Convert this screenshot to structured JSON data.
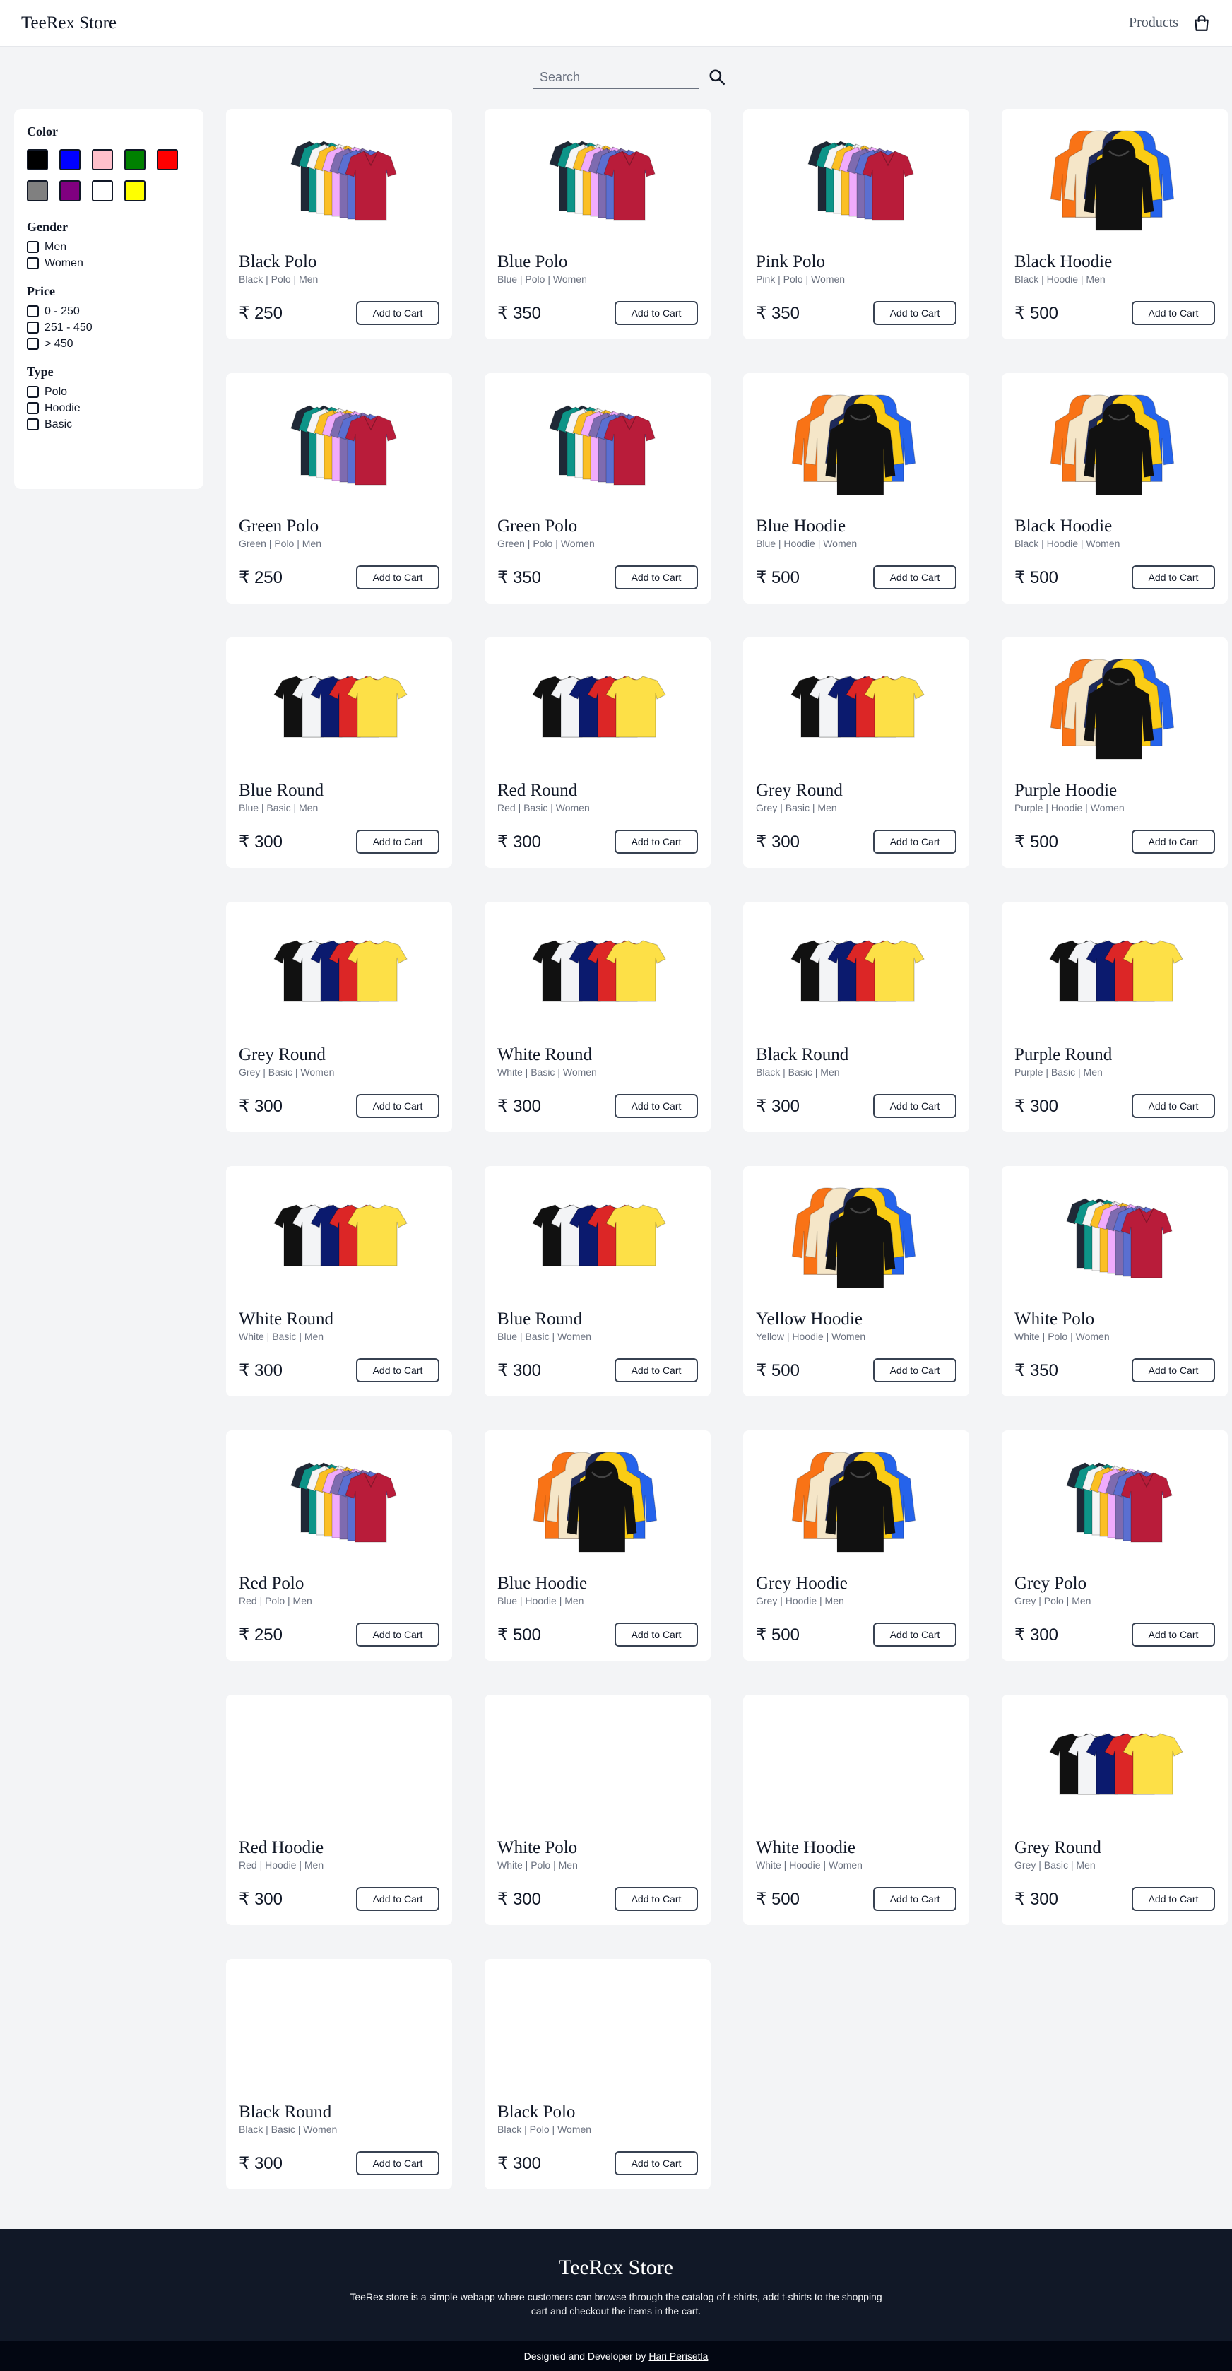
{
  "header": {
    "brand": "TeeRex Store",
    "nav_link": "Products",
    "cart_icon": "shopping-bag-icon"
  },
  "search": {
    "placeholder": "Search",
    "value": "",
    "icon": "search-icon"
  },
  "filters": {
    "color": {
      "title": "Color",
      "swatches": [
        {
          "name": "black",
          "hex": "#000000"
        },
        {
          "name": "blue",
          "hex": "#0000ff"
        },
        {
          "name": "pink",
          "hex": "#ffc0cb"
        },
        {
          "name": "green",
          "hex": "#008000"
        },
        {
          "name": "red",
          "hex": "#ff0000"
        },
        {
          "name": "grey",
          "hex": "#808080"
        },
        {
          "name": "purple",
          "hex": "#800080"
        },
        {
          "name": "white",
          "hex": "#ffffff"
        },
        {
          "name": "yellow",
          "hex": "#ffff00"
        }
      ]
    },
    "gender": {
      "title": "Gender",
      "options": [
        "Men",
        "Women"
      ]
    },
    "price": {
      "title": "Price",
      "options": [
        "0 - 250",
        "251 - 450",
        "> 450"
      ]
    },
    "type": {
      "title": "Type",
      "options": [
        "Polo",
        "Hoodie",
        "Basic"
      ]
    }
  },
  "products": [
    {
      "name": "Black Polo",
      "meta": "Black | Polo | Men",
      "price": "₹ 250",
      "image": "polo",
      "button": "Add to Cart"
    },
    {
      "name": "Blue Polo",
      "meta": "Blue | Polo | Women",
      "price": "₹ 350",
      "image": "polo",
      "button": "Add to Cart"
    },
    {
      "name": "Pink Polo",
      "meta": "Pink | Polo | Women",
      "price": "₹ 350",
      "image": "polo",
      "button": "Add to Cart"
    },
    {
      "name": "Black Hoodie",
      "meta": "Black | Hoodie | Men",
      "price": "₹ 500",
      "image": "hoodie",
      "button": "Add to Cart"
    },
    {
      "name": "Green Polo",
      "meta": "Green | Polo | Men",
      "price": "₹ 250",
      "image": "polo",
      "button": "Add to Cart"
    },
    {
      "name": "Green Polo",
      "meta": "Green | Polo | Women",
      "price": "₹ 350",
      "image": "polo",
      "button": "Add to Cart"
    },
    {
      "name": "Blue Hoodie",
      "meta": "Blue | Hoodie | Women",
      "price": "₹ 500",
      "image": "hoodie",
      "button": "Add to Cart"
    },
    {
      "name": "Black Hoodie",
      "meta": "Black | Hoodie | Women",
      "price": "₹ 500",
      "image": "hoodie",
      "button": "Add to Cart"
    },
    {
      "name": "Blue Round",
      "meta": "Blue | Basic | Men",
      "price": "₹ 300",
      "image": "round",
      "button": "Add to Cart"
    },
    {
      "name": "Red Round",
      "meta": "Red | Basic | Women",
      "price": "₹ 300",
      "image": "round",
      "button": "Add to Cart"
    },
    {
      "name": "Grey Round",
      "meta": "Grey | Basic | Men",
      "price": "₹ 300",
      "image": "round",
      "button": "Add to Cart"
    },
    {
      "name": "Purple Hoodie",
      "meta": "Purple | Hoodie | Women",
      "price": "₹ 500",
      "image": "hoodie",
      "button": "Add to Cart"
    },
    {
      "name": "Grey Round",
      "meta": "Grey | Basic | Women",
      "price": "₹ 300",
      "image": "round",
      "button": "Add to Cart"
    },
    {
      "name": "White Round",
      "meta": "White | Basic | Women",
      "price": "₹ 300",
      "image": "round",
      "button": "Add to Cart"
    },
    {
      "name": "Black Round",
      "meta": "Black | Basic | Men",
      "price": "₹ 300",
      "image": "round",
      "button": "Add to Cart"
    },
    {
      "name": "Purple Round",
      "meta": "Purple | Basic | Men",
      "price": "₹ 300",
      "image": "round",
      "button": "Add to Cart"
    },
    {
      "name": "White Round",
      "meta": "White | Basic | Men",
      "price": "₹ 300",
      "image": "round",
      "button": "Add to Cart"
    },
    {
      "name": "Blue Round",
      "meta": "Blue | Basic | Women",
      "price": "₹ 300",
      "image": "round",
      "button": "Add to Cart"
    },
    {
      "name": "Yellow Hoodie",
      "meta": "Yellow | Hoodie | Women",
      "price": "₹ 500",
      "image": "hoodie",
      "button": "Add to Cart"
    },
    {
      "name": "White Polo",
      "meta": "White | Polo | Women",
      "price": "₹ 350",
      "image": "polo",
      "button": "Add to Cart"
    },
    {
      "name": "Red Polo",
      "meta": "Red | Polo | Men",
      "price": "₹ 250",
      "image": "polo",
      "button": "Add to Cart"
    },
    {
      "name": "Blue Hoodie",
      "meta": "Blue | Hoodie | Men",
      "price": "₹ 500",
      "image": "hoodie",
      "button": "Add to Cart"
    },
    {
      "name": "Grey Hoodie",
      "meta": "Grey | Hoodie | Men",
      "price": "₹ 500",
      "image": "hoodie",
      "button": "Add to Cart"
    },
    {
      "name": "Grey Polo",
      "meta": "Grey | Polo | Men",
      "price": "₹ 300",
      "image": "polo",
      "button": "Add to Cart"
    },
    {
      "name": "Red Hoodie",
      "meta": "Red | Hoodie | Men",
      "price": "₹ 300",
      "image": "none",
      "button": "Add to Cart"
    },
    {
      "name": "White Polo",
      "meta": "White | Polo | Men",
      "price": "₹ 300",
      "image": "none",
      "button": "Add to Cart"
    },
    {
      "name": "White Hoodie",
      "meta": "White | Hoodie | Women",
      "price": "₹ 500",
      "image": "none",
      "button": "Add to Cart"
    },
    {
      "name": "Grey Round",
      "meta": "Grey | Basic | Men",
      "price": "₹ 300",
      "image": "round",
      "button": "Add to Cart"
    },
    {
      "name": "Black Round",
      "meta": "Black | Basic | Women",
      "price": "₹ 300",
      "image": "none",
      "button": "Add to Cart"
    },
    {
      "name": "Black Polo",
      "meta": "Black | Polo | Women",
      "price": "₹ 300",
      "image": "none",
      "button": "Add to Cart"
    }
  ],
  "footer": {
    "title": "TeeRex Store",
    "description": "TeeRex store is a simple webapp where customers can browse through the catalog of t-shirts, add t-shirts to the shopping cart and checkout the items in the cart.",
    "credit_prefix": "Designed and Developer by",
    "credit_name": "Hari Perisetla"
  }
}
